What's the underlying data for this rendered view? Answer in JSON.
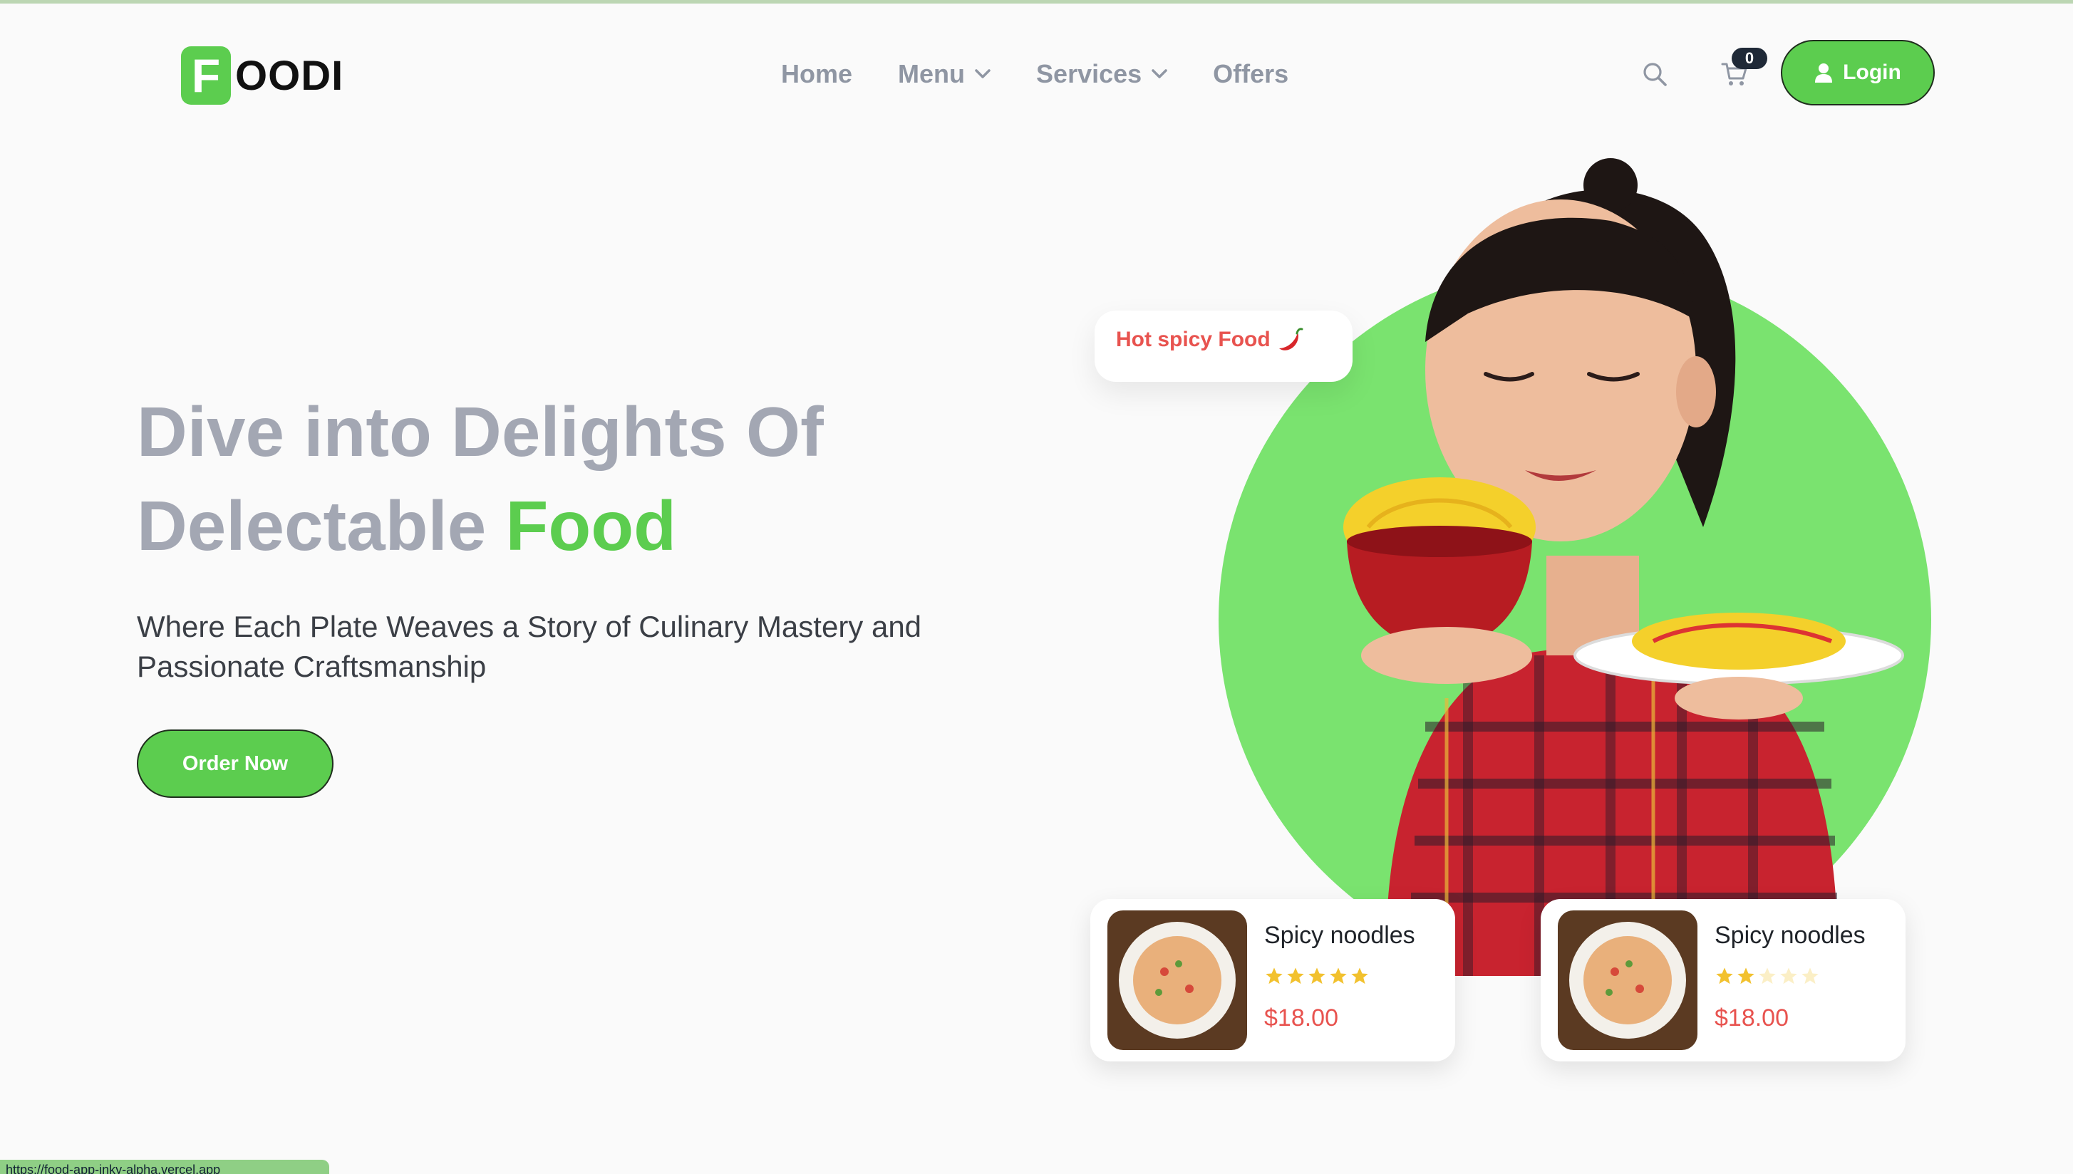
{
  "brand": {
    "logo_letter": "F",
    "logo_text": "OODI",
    "accent_color": "#5ccd4f",
    "price_color": "#e8534f"
  },
  "nav": {
    "items": [
      {
        "label": "Home",
        "has_dropdown": false
      },
      {
        "label": "Menu",
        "has_dropdown": true
      },
      {
        "label": "Services",
        "has_dropdown": true
      },
      {
        "label": "Offers",
        "has_dropdown": false
      }
    ],
    "cart_count": "0",
    "login_label": "Login",
    "icons": [
      "search-icon",
      "cart-icon",
      "user-icon",
      "chevron-down-icon"
    ]
  },
  "hero": {
    "headline_line1": "Dive into Delights Of",
    "headline_line2_plain": "Delectable",
    "headline_line2_accent": "Food",
    "subtitle": "Where Each Plate Weaves a Story of Culinary Mastery and Passionate Craftsmanship",
    "cta_label": "Order Now",
    "badge_text": "Hot spicy Food"
  },
  "products": [
    {
      "name": "Spicy noodles",
      "price": "$18.00",
      "rating": 5,
      "max_rating": 5
    },
    {
      "name": "Spicy noodles",
      "price": "$18.00",
      "rating": 2,
      "max_rating": 5
    }
  ],
  "status_bar": {
    "url": "https://food-app-inky-alpha.vercel.app"
  }
}
